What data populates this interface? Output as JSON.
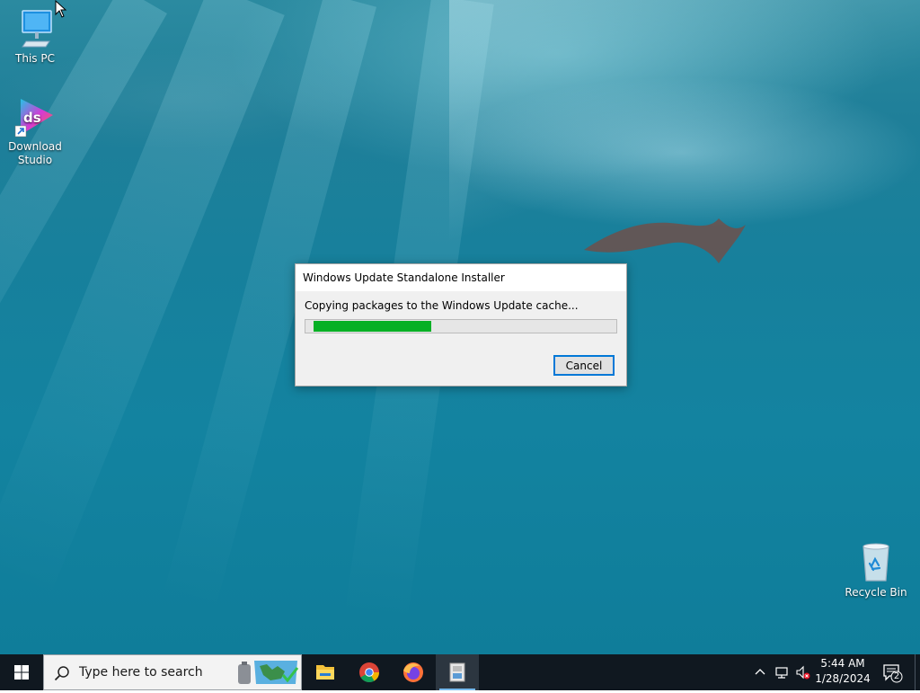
{
  "desktop": {
    "icons": [
      {
        "label": "This PC"
      },
      {
        "label": "Download Studio"
      },
      {
        "label": "Recycle Bin"
      }
    ]
  },
  "dialog": {
    "title": "Windows Update Standalone Installer",
    "message": "Copying packages to the Windows Update cache...",
    "progress_percent": 39,
    "cancel_label": "Cancel"
  },
  "taskbar": {
    "search_placeholder": "Type here to search",
    "apps": [
      "file-explorer-icon",
      "chrome-icon",
      "firefox-icon",
      "installer-icon"
    ],
    "clock_time": "5:44 AM",
    "clock_date": "1/28/2024",
    "notification_count": "2"
  },
  "colors": {
    "progress_fill": "#06b025",
    "focus_border": "#0078d7",
    "taskbar_bg": "#101820"
  }
}
